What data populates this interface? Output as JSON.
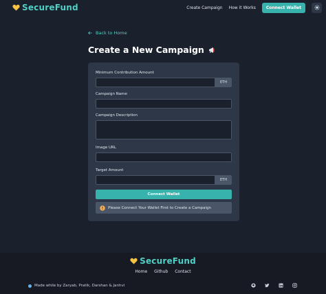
{
  "nav": {
    "brand": "SecureFund",
    "links": [
      "Create Campaign",
      "How it Works"
    ],
    "connect": "Connect Wallet"
  },
  "page": {
    "back": "Back to Home",
    "title": "Create a New Campaign"
  },
  "form": {
    "min_label": "Minimum Contribution Amount",
    "min_unit": "ETH",
    "name_label": "Campaign Name",
    "desc_label": "Campaign Description",
    "image_label": "Image URL",
    "target_label": "Target Amount",
    "target_unit": "ETH",
    "submit": "Connect Wallet",
    "alert": "Please Connect Your Wallet First to Create a Campaign"
  },
  "footer": {
    "brand": "SecureFund",
    "links": [
      "Home",
      "Github",
      "Contact"
    ],
    "credit": "Made while by Zaryab, Pratik, Darshan & Janhvi"
  },
  "colors": {
    "accent": "#38b2ac",
    "brand": "#4fd1c5",
    "background": "#1a202c",
    "card": "#2d3748",
    "heart": "#f6c343"
  }
}
